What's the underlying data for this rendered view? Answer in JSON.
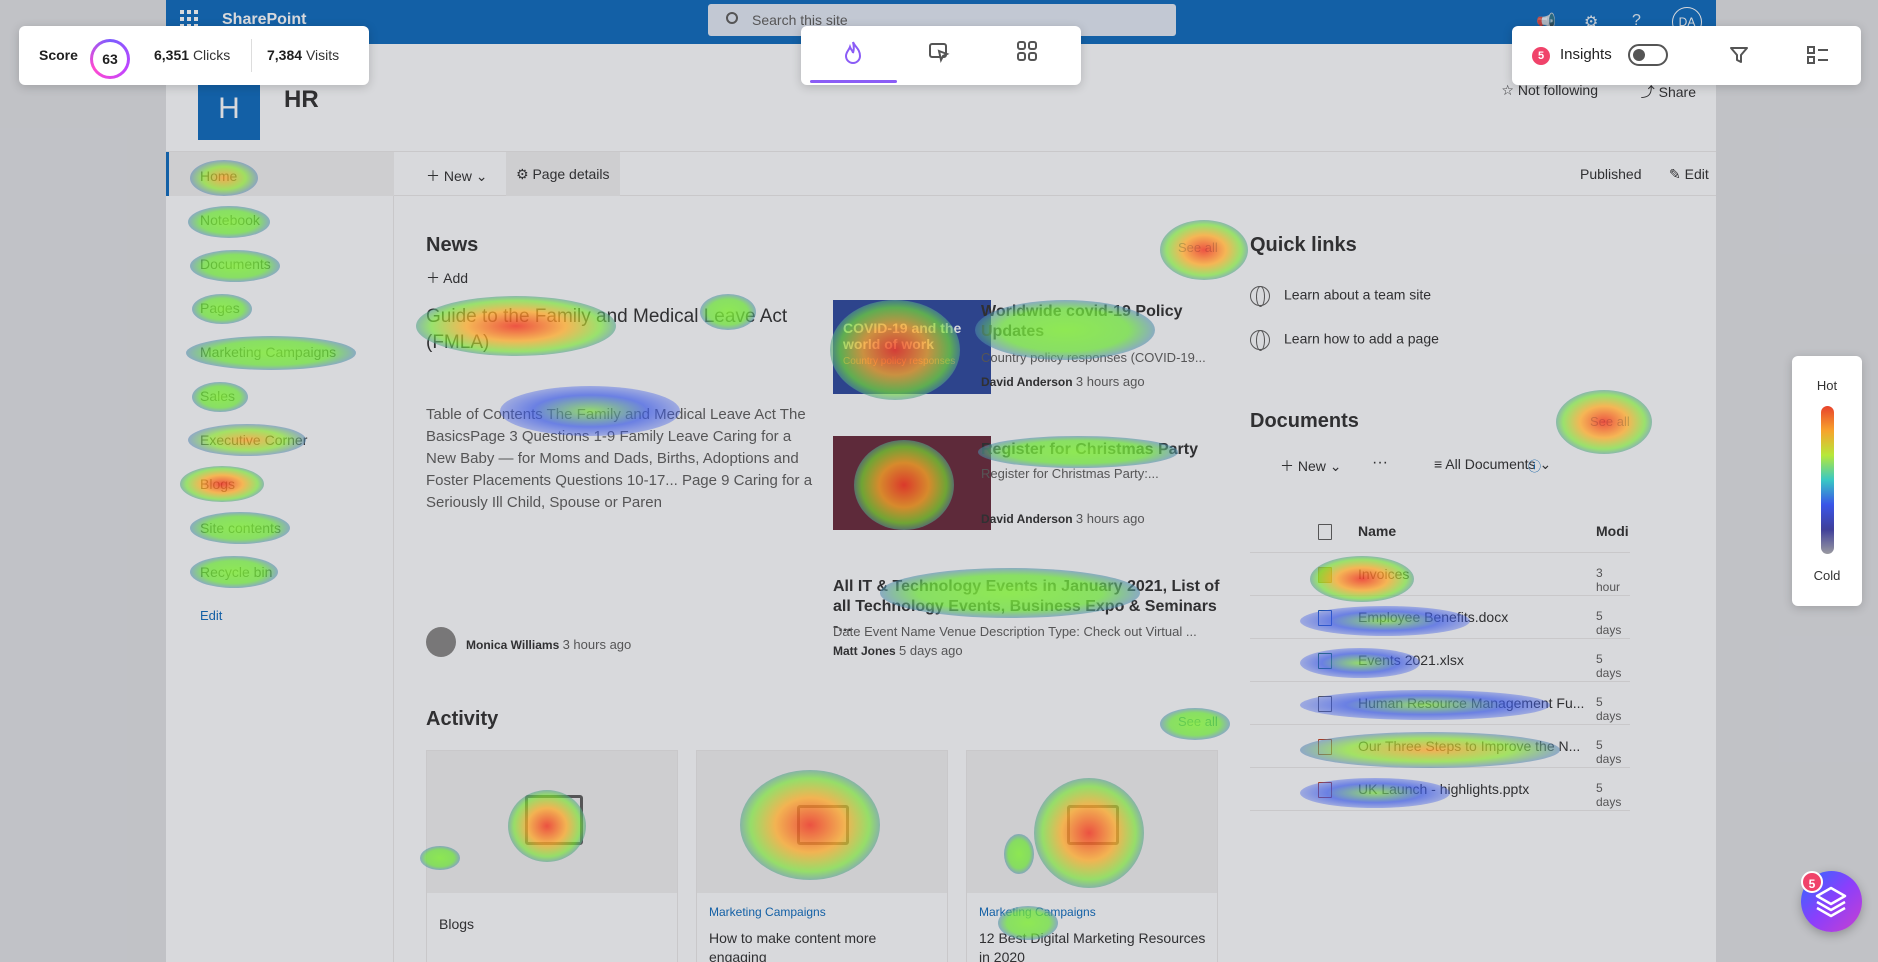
{
  "sharepoint": {
    "brand": "SharePoint",
    "search_placeholder": "Search this site",
    "me_initials": "DA",
    "site": {
      "logo_letter": "H",
      "title": "HR",
      "follow": "Not following",
      "share": "Share"
    },
    "leftnav": [
      "Home",
      "Notebook",
      "Documents",
      "Pages",
      "Marketing Campaigns",
      "Sales",
      "Executive Corner",
      "Blogs",
      "Site contents",
      "Recycle bin"
    ],
    "leftnav_edit": "Edit",
    "cmdbar": {
      "new": "New",
      "page_details": "Page details",
      "published": "Published",
      "edit": "Edit"
    }
  },
  "news": {
    "heading": "News",
    "add": "Add",
    "see_all": "See all",
    "main": {
      "title": "Guide to the Family and Medical Leave Act (FMLA)",
      "desc": "Table of Contents The Family and Medical Leave Act The BasicsPage 3 Questions 1-9 Family Leave Caring for a New Baby — for Moms and Dads, Births, Adoptions and Foster Placements Questions 10-17... Page 9 Caring for a Seriously Ill Child, Spouse or Paren",
      "author": "Monica Williams",
      "time": "3 hours ago"
    },
    "items": [
      {
        "title": "Worldwide covid-19 Policy Updates",
        "desc": "Country policy responses (COVID-19...",
        "author": "David Anderson",
        "time": "3 hours ago",
        "thumb_text": "COVID-19 and the world of work",
        "thumb_sub": "Country policy responses"
      },
      {
        "title": "Register for Christmas Party",
        "desc": "Register for Christmas Party:...",
        "author": "David Anderson",
        "time": "3 hours ago"
      },
      {
        "title": "All IT & Technology Events in January 2021, List of all Technology Events, Business Expo & Seminars -...",
        "desc": "Date Event Name Venue Description Type: Check out Virtual ...",
        "author": "Matt Jones",
        "time": "5 days ago"
      }
    ]
  },
  "quicklinks": {
    "heading": "Quick links",
    "items": [
      "Learn about a team site",
      "Learn how to add a page"
    ]
  },
  "documents": {
    "heading": "Documents",
    "see_all": "See all",
    "new": "New",
    "view": "All Documents",
    "col_name": "Name",
    "col_mod": "Modi",
    "rows": [
      {
        "name": "Invoices",
        "mod": "3 hour"
      },
      {
        "name": "Employee Benefits.docx",
        "mod": "5 days"
      },
      {
        "name": "Events 2021.xlsx",
        "mod": "5 days"
      },
      {
        "name": "Human Resource Management Fu...",
        "mod": "5 days"
      },
      {
        "name": "Our Three Steps to Improve the N...",
        "mod": "5 days"
      },
      {
        "name": "UK Launch - highlights.pptx",
        "mod": "5 days"
      }
    ]
  },
  "activity": {
    "heading": "Activity",
    "see_all": "See all",
    "cards": [
      {
        "site": "",
        "title": "Blogs"
      },
      {
        "site": "Marketing Campaigns",
        "title": "How to make content more engaging"
      },
      {
        "site": "Marketing Campaigns",
        "title": "12 Best Digital Marketing Resources in 2020"
      }
    ]
  },
  "overlay": {
    "score_label": "Score",
    "score": "63",
    "clicks": "6,351",
    "clicks_label": "Clicks",
    "visits": "7,384",
    "visits_label": "Visits",
    "insights_count": "5",
    "insights_label": "Insights",
    "legend_hot": "Hot",
    "legend_cold": "Cold",
    "fab_badge": "5",
    "accent": "#8b5cf6"
  }
}
